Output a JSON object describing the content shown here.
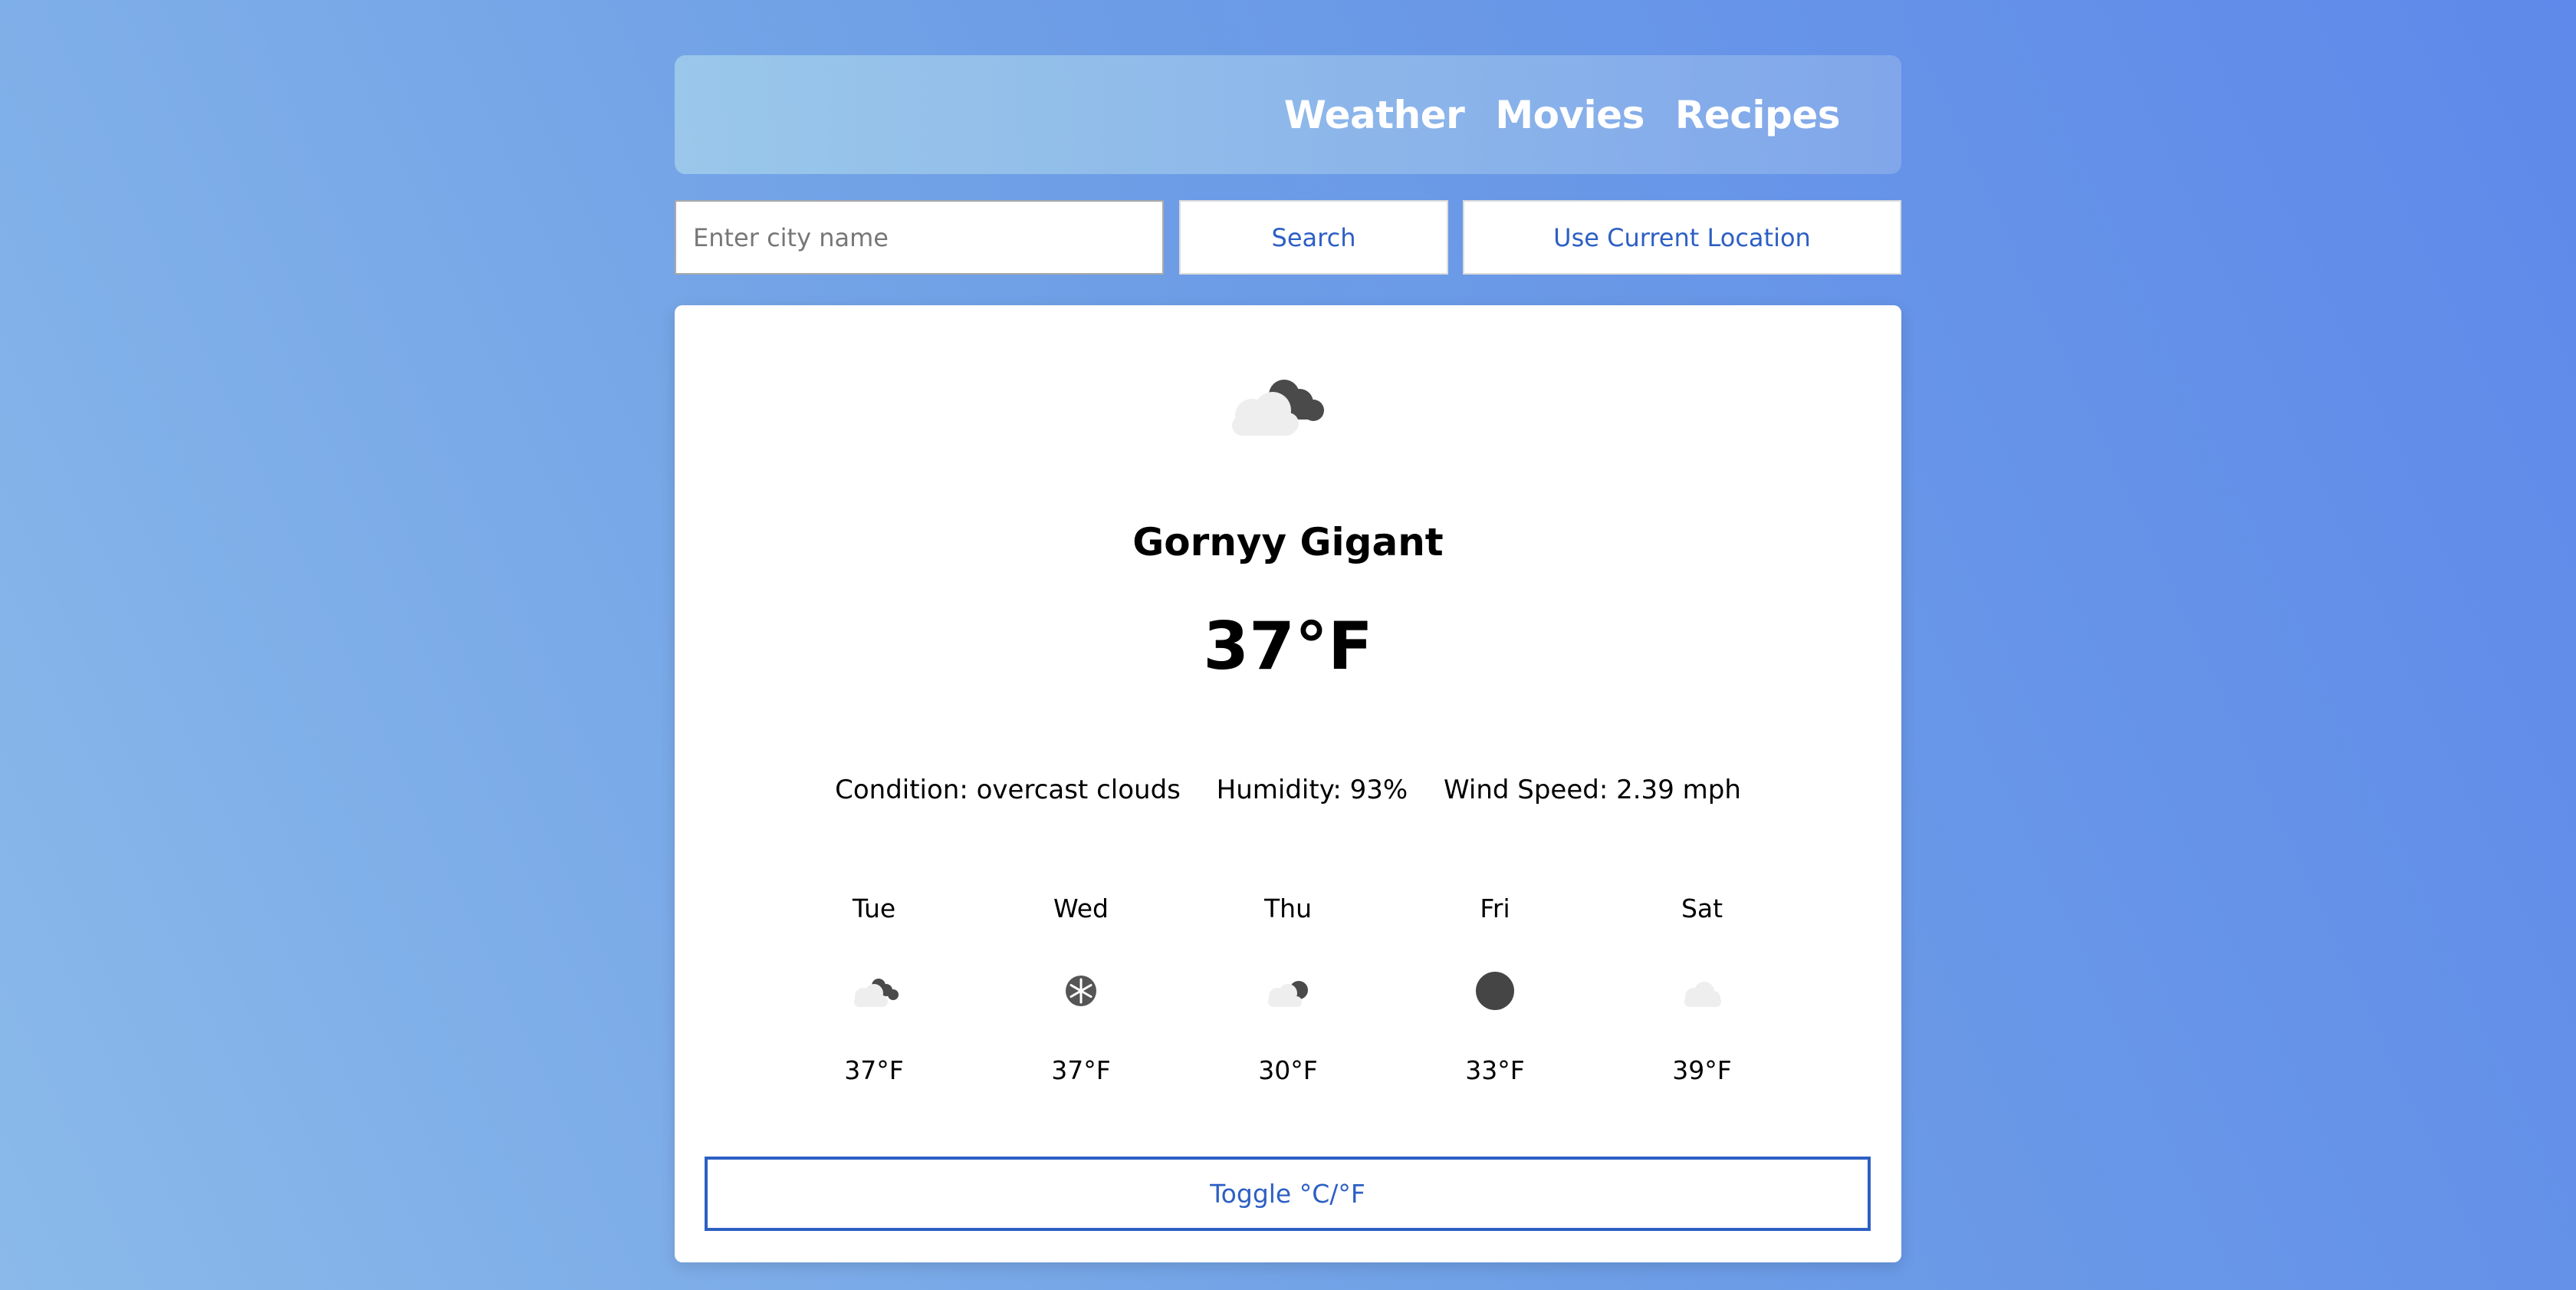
{
  "nav": {
    "links": [
      "Weather",
      "Movies",
      "Recipes"
    ]
  },
  "search": {
    "placeholder": "Enter city name",
    "value": "",
    "search_label": "Search",
    "location_label": "Use Current Location"
  },
  "current": {
    "icon": "broken-clouds-icon",
    "city": "Gornyy Gigant",
    "temperature": "37°F",
    "condition": "Condition: overcast clouds",
    "humidity": "Humidity: 93%",
    "wind": "Wind Speed: 2.39 mph"
  },
  "forecast": [
    {
      "day": "Tue",
      "icon": "broken-clouds-icon",
      "temp": "37°F"
    },
    {
      "day": "Wed",
      "icon": "snow-icon",
      "temp": "37°F"
    },
    {
      "day": "Thu",
      "icon": "partly-cloudy-icon",
      "temp": "30°F"
    },
    {
      "day": "Fri",
      "icon": "clear-icon",
      "temp": "33°F"
    },
    {
      "day": "Sat",
      "icon": "cloud-icon",
      "temp": "39°F"
    }
  ],
  "toggle_label": "Toggle °C/°F",
  "colors": {
    "accent": "#2d5fc4",
    "background_start": "#8ab9ea",
    "background_end": "#5f89ea"
  }
}
